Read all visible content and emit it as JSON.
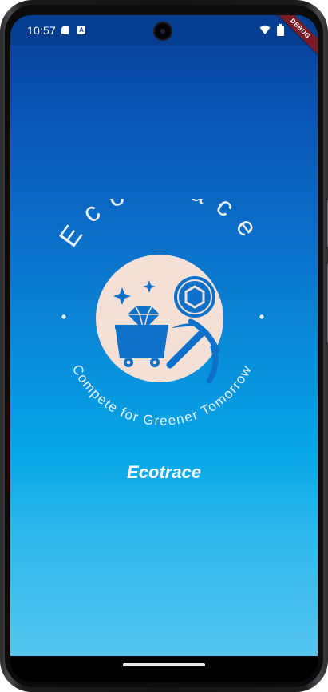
{
  "status_bar": {
    "time": "10:57",
    "icons": [
      "sd-card-icon",
      "a-notification-icon",
      "front-camera",
      "wifi-icon",
      "battery-icon"
    ]
  },
  "debug_banner": "DEBUG",
  "logo": {
    "top_text": "EcoTrace",
    "bottom_text": "Compete for Greener Tomorrow",
    "icons": [
      "sparkle-icon",
      "diamond-cart-icon",
      "pickaxe-icon",
      "hexagon-badge-icon"
    ],
    "colors": {
      "circle": "#f4e0d6",
      "icon": "#0d71c9",
      "text": "#e9f3fb"
    }
  },
  "app_name": "Ecotrace",
  "colors": {
    "gradient_top": "#053e97",
    "gradient_bottom": "#55c5ef",
    "status_bar": "#053e90",
    "debug_ribbon": "#7b1b26"
  }
}
